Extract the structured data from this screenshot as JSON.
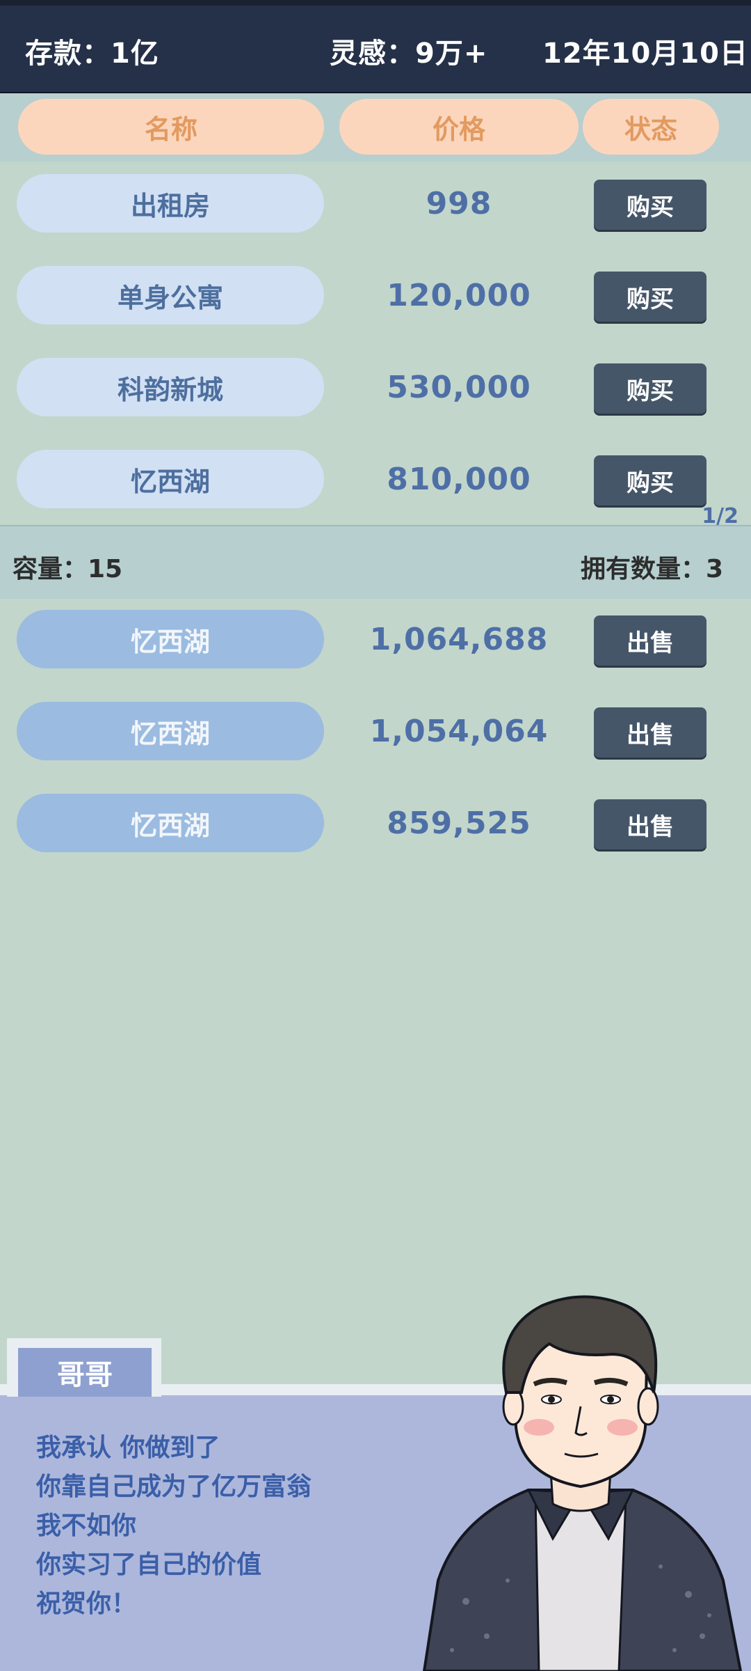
{
  "header": {
    "deposit": "存款：1亿",
    "inspiration": "灵感：9万+",
    "date": "12年10月10日"
  },
  "columns": {
    "name": "名称",
    "price": "价格",
    "status": "状态"
  },
  "shop": [
    {
      "name": "出租房",
      "price": "998",
      "action": "购买"
    },
    {
      "name": "单身公寓",
      "price": "120,000",
      "action": "购买"
    },
    {
      "name": "科韵新城",
      "price": "530,000",
      "action": "购买"
    },
    {
      "name": "忆西湖",
      "price": "810,000",
      "action": "购买"
    }
  ],
  "pager": "1/2",
  "inventory": {
    "capacity": "容量：15",
    "owned_count": "拥有数量：3"
  },
  "owned": [
    {
      "name": "忆西湖",
      "price": "1,064,688",
      "action": "出售"
    },
    {
      "name": "忆西湖",
      "price": "1,054,064",
      "action": "出售"
    },
    {
      "name": "忆西湖",
      "price": "859,525",
      "action": "出售"
    }
  ],
  "dialog": {
    "speaker": "哥哥",
    "lines": [
      "我承认 你做到了",
      "你靠自己成为了亿万富翁",
      "我不如你",
      "你实习了自己的价值",
      "祝贺你！"
    ]
  },
  "colors": {
    "header_bg": "#253148",
    "page_bg": "#c2d6cb",
    "pill_peach": "#fbd6bd",
    "button_bg": "#465669",
    "dialog_bg": "#adb7dc"
  }
}
